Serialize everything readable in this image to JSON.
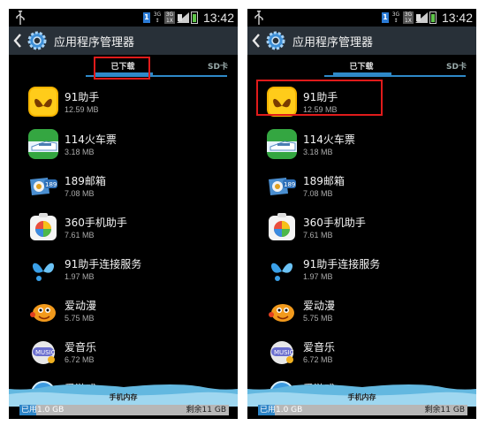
{
  "clock": "13:42",
  "title": "应用程序管理器",
  "tabs": {
    "downloaded": "已下载",
    "sd_card": "SD卡"
  },
  "net_label_top": "3G",
  "net_label_sub": "1X",
  "apps": [
    {
      "name": "91助手",
      "size": "12.59 MB",
      "icon": "91-assistant-icon"
    },
    {
      "name": "114火车票",
      "size": "3.18 MB",
      "icon": "train-ticket-icon"
    },
    {
      "name": "189邮箱",
      "size": "7.08 MB",
      "icon": "mail-189-icon"
    },
    {
      "name": "360手机助手",
      "size": "7.61 MB",
      "icon": "360-assistant-icon"
    },
    {
      "name": "91助手连接服务",
      "size": "1.97 MB",
      "icon": "91-connect-icon"
    },
    {
      "name": "爱动漫",
      "size": "5.75 MB",
      "icon": "anime-icon"
    },
    {
      "name": "爱音乐",
      "size": "6.72 MB",
      "icon": "music-icon"
    },
    {
      "name": "爱游戏",
      "size": "",
      "icon": "game-icon"
    }
  ],
  "storage": {
    "label": "手机内存",
    "used": "已用1.0 GB",
    "free": "剩余11 GB",
    "used_fraction": 0.08
  },
  "colors": {
    "accent": "#2e89c8",
    "highlight": "#e01b1b",
    "titlebar": "#283038"
  }
}
